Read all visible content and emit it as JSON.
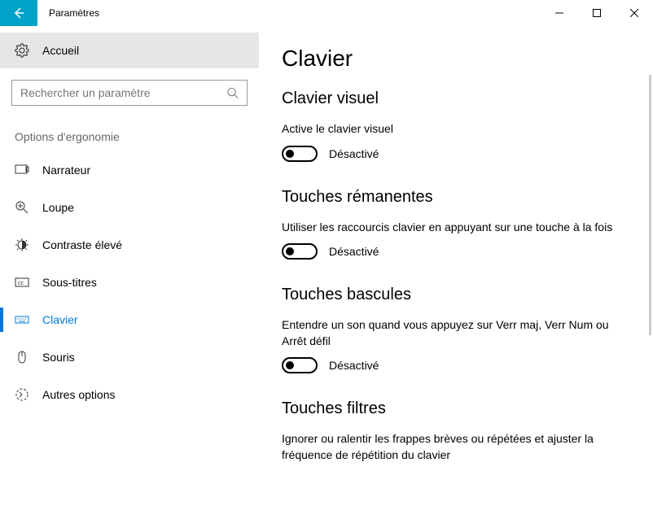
{
  "window": {
    "title": "Paramètres"
  },
  "sidebar": {
    "home": "Accueil",
    "search_placeholder": "Rechercher un paramètre",
    "category": "Options d'ergonomie",
    "items": [
      {
        "label": "Narrateur"
      },
      {
        "label": "Loupe"
      },
      {
        "label": "Contraste élevé"
      },
      {
        "label": "Sous-titres"
      },
      {
        "label": "Clavier"
      },
      {
        "label": "Souris"
      },
      {
        "label": "Autres options"
      }
    ]
  },
  "content": {
    "heading": "Clavier",
    "sections": [
      {
        "title": "Clavier visuel",
        "desc": "Active le clavier visuel",
        "toggle_label": "Désactivé"
      },
      {
        "title": "Touches rémanentes",
        "desc": "Utiliser les raccourcis clavier en appuyant sur une touche à la fois",
        "toggle_label": "Désactivé"
      },
      {
        "title": "Touches bascules",
        "desc": "Entendre un son quand vous appuyez sur Verr maj, Verr Num ou Arrêt défil",
        "toggle_label": "Désactivé"
      },
      {
        "title": "Touches filtres",
        "desc": "Ignorer ou ralentir les frappes brèves ou répétées et ajuster la fréquence de répétition du clavier"
      }
    ]
  }
}
